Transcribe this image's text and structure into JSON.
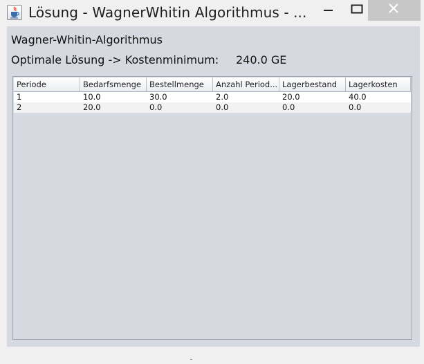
{
  "window": {
    "title": "Lösung - WagnerWhitin Algorithmus - ...",
    "icon": "java-cup-icon",
    "controls": [
      "minimize-icon",
      "maximize-icon",
      "close-icon"
    ]
  },
  "content": {
    "heading": "Wagner-Whitin-Algorithmus",
    "cost_label": "Optimale Lösung -> Kostenminimum:",
    "cost_value": "240.0 GE"
  },
  "table": {
    "columns": [
      "Periode",
      "Bedarfsmenge",
      "Bestellmenge",
      "Anzahl Period...",
      "Lagerbestand",
      "Lagerkosten"
    ],
    "rows": [
      [
        "1",
        "10.0",
        "30.0",
        "2.0",
        "20.0",
        "40.0"
      ],
      [
        "2",
        "20.0",
        "0.0",
        "0.0",
        "0.0",
        "0.0"
      ]
    ]
  },
  "colors": {
    "client_bg": "#d6d9df",
    "close_button_bg": "#c7c7c7"
  }
}
